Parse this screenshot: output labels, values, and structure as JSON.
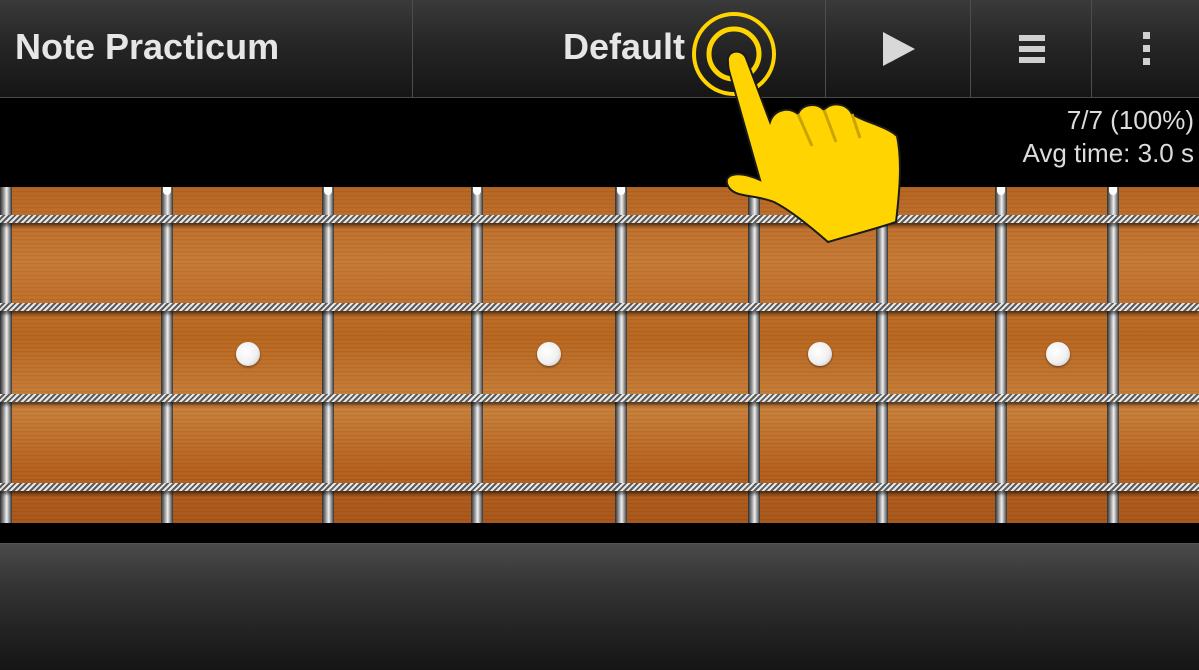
{
  "app": {
    "title": "Note Practicum"
  },
  "toolbar": {
    "preset_label": "Default",
    "play_icon": "play-icon",
    "list_icon": "list-icon",
    "overflow_icon": "overflow-menu-icon"
  },
  "stats": {
    "score": "7/7 (100%)",
    "avg_time": "Avg time: 3.0 s"
  },
  "fretboard": {
    "strings": 4,
    "inlay_color": "#ffffff",
    "wood_color": "#b8661f"
  },
  "overlay": {
    "tap_hint_icon": "tap-hand-icon",
    "accent": "#ffd400"
  }
}
